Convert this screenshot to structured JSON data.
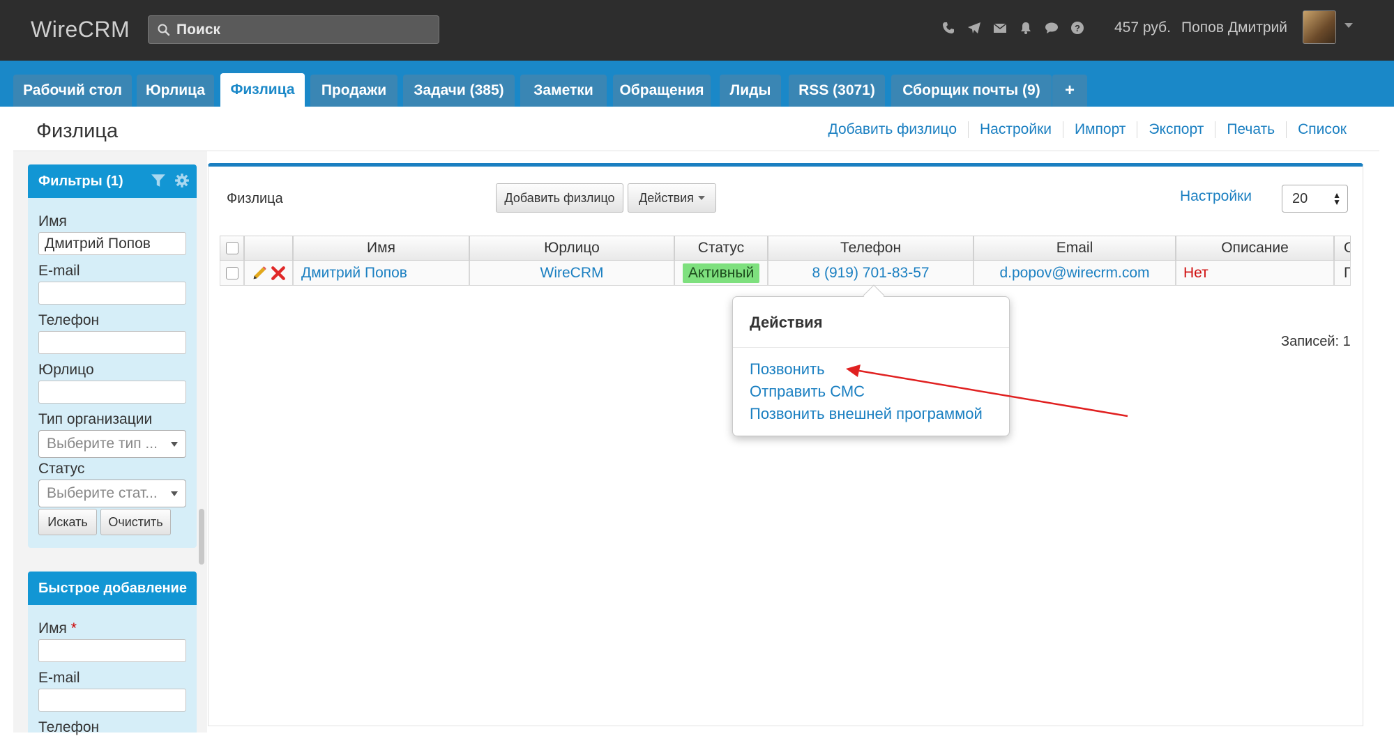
{
  "app": {
    "logo": "WireCRM"
  },
  "search": {
    "placeholder": "Поиск"
  },
  "topbar": {
    "icons": [
      "phone-icon",
      "send-icon",
      "mail-icon",
      "bell-icon",
      "chat-icon",
      "help-icon"
    ],
    "balance": "457 руб.",
    "user": "Попов Дмитрий"
  },
  "tabs": [
    {
      "label": "Рабочий стол",
      "active": false
    },
    {
      "label": "Юрлица",
      "active": false
    },
    {
      "label": "Физлица",
      "active": true
    },
    {
      "label": "Продажи",
      "active": false
    },
    {
      "label": "Задачи (385)",
      "active": false
    },
    {
      "label": "Заметки",
      "active": false
    },
    {
      "label": "Обращения",
      "active": false
    },
    {
      "label": "Лиды",
      "active": false
    },
    {
      "label": "RSS (3071)",
      "active": false
    },
    {
      "label": "Сборщик почты (9)",
      "active": false
    },
    {
      "label": "+",
      "active": false
    }
  ],
  "page": {
    "title": "Физлица",
    "links": [
      "Добавить физлицо",
      "Настройки",
      "Импорт",
      "Экспорт",
      "Печать",
      "Список"
    ]
  },
  "filters": {
    "title": "Фильтры (1)",
    "name_label": "Имя",
    "name_value": "Дмитрий Попов",
    "email_label": "E-mail",
    "phone_label": "Телефон",
    "company_label": "Юрлицо",
    "orgtype_label": "Тип организации",
    "orgtype_placeholder": "Выберите тип ...",
    "status_label": "Статус",
    "status_placeholder": "Выберите стат...",
    "search_button": "Искать",
    "clear_button": "Очистить"
  },
  "quickadd": {
    "title": "Быстрое добавление",
    "name_label": "Имя",
    "required_mark": "*",
    "email_label": "E-mail",
    "phone_label": "Телефон"
  },
  "main": {
    "title": "Физлица",
    "add_button": "Добавить физлицо",
    "actions_button": "Действия",
    "settings_link": "Настройки",
    "per_page": "20",
    "records": "Записей: 1"
  },
  "table": {
    "columns": [
      "Имя",
      "Юрлицо",
      "Статус",
      "Телефон",
      "Email",
      "Описание",
      "О"
    ],
    "rows": [
      {
        "name": "Дмитрий Попов",
        "company": "WireCRM",
        "status": "Активный",
        "phone": "8 (919) 701-83-57",
        "email": "d.popov@wirecrm.com",
        "description": "Нет",
        "extra": "П"
      }
    ]
  },
  "popover": {
    "title": "Действия",
    "items": [
      "Позвонить",
      "Отправить СМС",
      "Позвонить внешней программой"
    ]
  },
  "colors": {
    "topbar": "#2d2d2d",
    "tabbar": "#1a88c8",
    "link": "#1a7fc1",
    "status_active": "#7ee07e",
    "annotation_arrow": "#e02020"
  }
}
